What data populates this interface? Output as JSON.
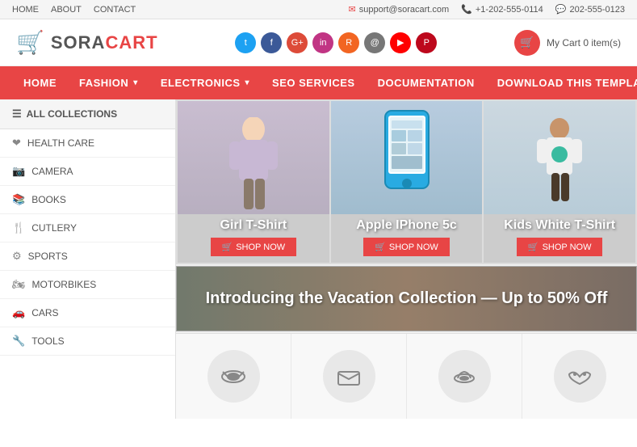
{
  "topbar": {
    "links": [
      "HOME",
      "ABOUT",
      "CONTACT"
    ],
    "email": "support@soracart.com",
    "phone": "+1-202-555-0114",
    "whatsapp": "202-555-0123"
  },
  "header": {
    "logo_sora": "SORA",
    "logo_cart": "CART",
    "social": [
      "T",
      "f",
      "G+",
      "in",
      "RSS",
      "@",
      "▶",
      "P"
    ],
    "cart_label": "My Cart 0 item(s)"
  },
  "nav": {
    "items": [
      {
        "label": "HOME",
        "dropdown": false
      },
      {
        "label": "FASHION",
        "dropdown": true
      },
      {
        "label": "ELECTRONICS",
        "dropdown": true
      },
      {
        "label": "SEO SERVICES",
        "dropdown": false
      },
      {
        "label": "DOCUMENTATION",
        "dropdown": false
      },
      {
        "label": "DOWNLOAD THIS TEMPLATE",
        "dropdown": false
      }
    ]
  },
  "sidebar": {
    "header": "ALL COLLECTIONS",
    "items": [
      {
        "label": "HEALTH CARE",
        "icon": "❤"
      },
      {
        "label": "CAMERA",
        "icon": "📷"
      },
      {
        "label": "BOOKS",
        "icon": "📚"
      },
      {
        "label": "CUTLERY",
        "icon": "🍴"
      },
      {
        "label": "SPORTS",
        "icon": "⚙"
      },
      {
        "label": "MOTORBIKES",
        "icon": "🏍"
      },
      {
        "label": "CARS",
        "icon": "🚗"
      },
      {
        "label": "TOOLS",
        "icon": "🔧"
      }
    ]
  },
  "hero": {
    "cards": [
      {
        "title": "Girl T-Shirt",
        "btn": "SHOP NOW"
      },
      {
        "title": "Apple IPhone 5c",
        "btn": "SHOP NOW"
      },
      {
        "title": "Kids White T-Shirt",
        "btn": "SHOP NOW"
      }
    ]
  },
  "vacation": {
    "text": "Introducing the Vacation Collection — Up to 50% Off"
  },
  "bottom_cats": [
    {
      "icon": "👒"
    },
    {
      "icon": "✉"
    },
    {
      "icon": "💄"
    },
    {
      "icon": "🦋"
    }
  ]
}
